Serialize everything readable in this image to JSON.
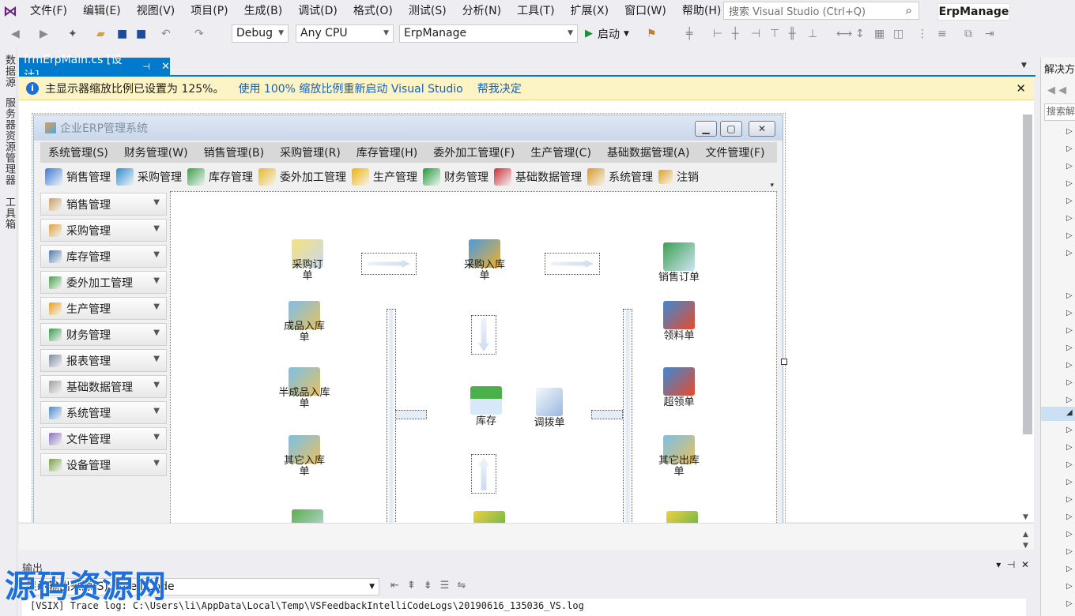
{
  "menubar": {
    "items": [
      "文件(F)",
      "编辑(E)",
      "视图(V)",
      "项目(P)",
      "生成(B)",
      "调试(D)",
      "格式(O)",
      "测试(S)",
      "分析(N)",
      "工具(T)",
      "扩展(X)",
      "窗口(W)",
      "帮助(H)"
    ],
    "search_placeholder": "搜索 Visual Studio (Ctrl+Q)",
    "solution_name": "ErpManage"
  },
  "toolbar": {
    "config": "Debug",
    "platform": "Any CPU",
    "startup_project": "ErpManage",
    "start_label": "启动"
  },
  "left_rail": [
    "数据源",
    "服务器资源管理器",
    "工具箱"
  ],
  "doc_tab": {
    "label": "frmErpMain.cs [设计]"
  },
  "infobar": {
    "message": "主显示器缩放比例已设置为 125%。",
    "link1": "使用 100% 缩放比例重新启动 Visual Studio",
    "link2": "帮我决定"
  },
  "form": {
    "title": "企业ERP管理系统",
    "menu": [
      "系统管理(S)",
      "财务管理(W)",
      "销售管理(B)",
      "采购管理(R)",
      "库存管理(H)",
      "委外加工管理(F)",
      "生产管理(C)",
      "基础数据管理(A)",
      "文件管理(F)"
    ],
    "toolbar": [
      {
        "label": "销售管理",
        "color": "#3a7bd5"
      },
      {
        "label": "采购管理",
        "color": "#2a8fd0"
      },
      {
        "label": "库存管理",
        "color": "#3aa04a"
      },
      {
        "label": "委外加工管理",
        "color": "#e8b82a"
      },
      {
        "label": "生产管理",
        "color": "#f0b400"
      },
      {
        "label": "财务管理",
        "color": "#1f9a3a"
      },
      {
        "label": "基础数据管理",
        "color": "#c8303a"
      },
      {
        "label": "系统管理",
        "color": "#d89a2a"
      },
      {
        "label": "注销",
        "color": "#e0a020"
      }
    ],
    "nav": [
      {
        "label": "销售管理",
        "color": "#c8a060"
      },
      {
        "label": "采购管理",
        "color": "#e0a040"
      },
      {
        "label": "库存管理",
        "color": "#4a7ab0"
      },
      {
        "label": "委外加工管理",
        "color": "#4aa050"
      },
      {
        "label": "生产管理",
        "color": "#e8a020"
      },
      {
        "label": "财务管理",
        "color": "#3a9a4a"
      },
      {
        "label": "报表管理",
        "color": "#7a8aa0"
      },
      {
        "label": "基础数据管理",
        "color": "#a0a0a0"
      },
      {
        "label": "系统管理",
        "color": "#4a8ad0"
      },
      {
        "label": "文件管理",
        "color": "#8a70c0"
      },
      {
        "label": "设备管理",
        "color": "#7aa040"
      }
    ],
    "flow": {
      "purchase_order": "采购订单",
      "purchase_receipt": "采购入库单",
      "sales_order": "销售订单",
      "finished_receipt": "成品入库单",
      "material_requisition": "领料单",
      "semi_receipt": "半成品入库单",
      "inventory": "库存",
      "transfer": "调拨单",
      "over_requisition": "超领单",
      "other_receipt": "其它入库单",
      "other_issue": "其它出库单"
    }
  },
  "output": {
    "title": "输出",
    "source_label": "显示输出来源(S):",
    "source_value": "IntelliCode",
    "log_line": "[VSIX] Trace log: C:\\Users\\li\\AppData\\Local\\Temp\\VSFeedbackIntelliCodeLogs\\20190616_135036_VS.log"
  },
  "right_panel": {
    "title": "解决方案资源管理器",
    "search_placeholder": "搜索解决方案资源管理器"
  },
  "watermark": {
    "text": "源码资源网"
  }
}
